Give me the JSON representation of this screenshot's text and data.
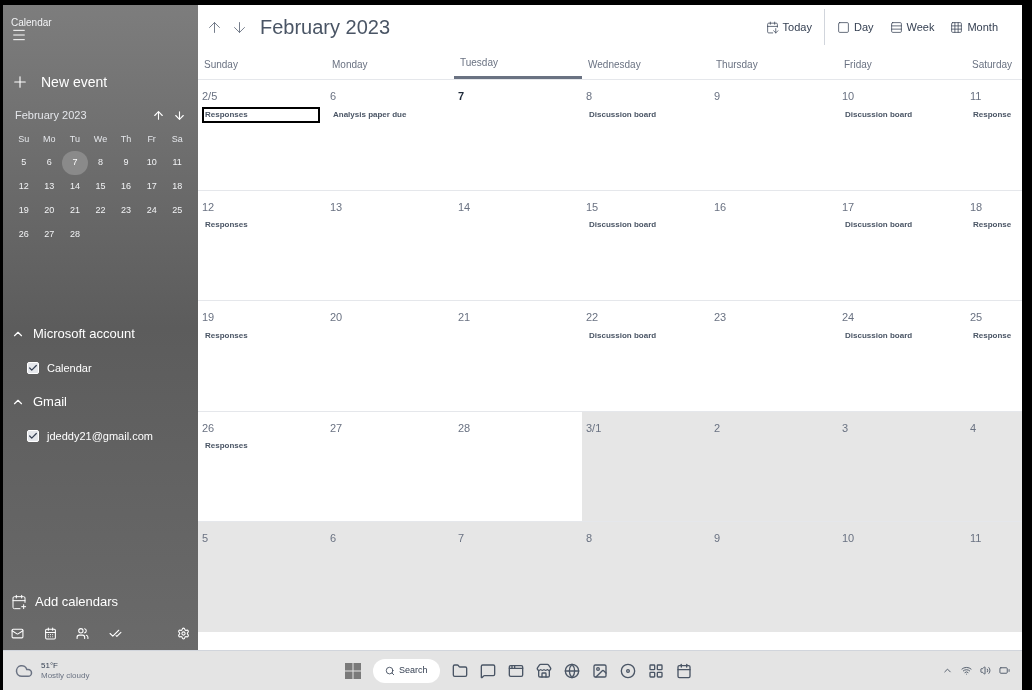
{
  "window": {
    "title": "Calendar"
  },
  "sidebar": {
    "new_event": "New event",
    "mini_calendar": {
      "month": "February 2023",
      "weekdays": [
        "Su",
        "Mo",
        "Tu",
        "We",
        "Th",
        "Fr",
        "Sa"
      ],
      "weeks": [
        [
          {
            "day": "5",
            "today": false
          },
          {
            "day": "6",
            "today": false
          },
          {
            "day": "7",
            "today": true
          },
          {
            "day": "8",
            "today": false
          },
          {
            "day": "9",
            "today": false
          },
          {
            "day": "10",
            "today": false
          },
          {
            "day": "11",
            "today": false
          }
        ],
        [
          {
            "day": "12",
            "today": false
          },
          {
            "day": "13",
            "today": false
          },
          {
            "day": "14",
            "today": false
          },
          {
            "day": "15",
            "today": false
          },
          {
            "day": "16",
            "today": false
          },
          {
            "day": "17",
            "today": false
          },
          {
            "day": "18",
            "today": false
          }
        ],
        [
          {
            "day": "19",
            "today": false
          },
          {
            "day": "20",
            "today": false
          },
          {
            "day": "21",
            "today": false
          },
          {
            "day": "22",
            "today": false
          },
          {
            "day": "23",
            "today": false
          },
          {
            "day": "24",
            "today": false
          },
          {
            "day": "25",
            "today": false
          }
        ],
        [
          {
            "day": "26",
            "today": false
          },
          {
            "day": "27",
            "today": false
          },
          {
            "day": "28",
            "today": false
          }
        ]
      ]
    },
    "accounts": [
      {
        "name": "Microsoft account",
        "expanded": true,
        "calendars": [
          {
            "label": "Calendar",
            "checked": true
          }
        ]
      },
      {
        "name": "Gmail",
        "expanded": true,
        "calendars": [
          {
            "label": "jdeddy21@gmail.com",
            "checked": true
          }
        ]
      }
    ],
    "add_calendars": "Add calendars"
  },
  "header": {
    "title": "February 2023",
    "views": [
      {
        "label": "Today",
        "kind": "today"
      },
      {
        "label": "Day",
        "kind": "day"
      },
      {
        "label": "Week",
        "kind": "week"
      },
      {
        "label": "Month",
        "kind": "month"
      }
    ]
  },
  "grid": {
    "weekdays": [
      {
        "label": "Sunday",
        "today": false
      },
      {
        "label": "Monday",
        "today": false
      },
      {
        "label": "Tuesday",
        "today": true
      },
      {
        "label": "Wednesday",
        "today": false
      },
      {
        "label": "Thursday",
        "today": false
      },
      {
        "label": "Friday",
        "today": false
      },
      {
        "label": "Saturday",
        "today": false
      }
    ],
    "weeks": [
      [
        {
          "date": "2/5",
          "in_month": true,
          "today": false,
          "event": {
            "title": "Responses",
            "selected": true
          }
        },
        {
          "date": "6",
          "in_month": true,
          "today": false,
          "event": {
            "title": "Analysis paper due",
            "selected": false
          }
        },
        {
          "date": "7",
          "in_month": true,
          "today": true
        },
        {
          "date": "8",
          "in_month": true,
          "today": false,
          "event": {
            "title": "Discussion board",
            "selected": false
          }
        },
        {
          "date": "9",
          "in_month": true,
          "today": false
        },
        {
          "date": "10",
          "in_month": true,
          "today": false,
          "event": {
            "title": "Discussion board",
            "selected": false
          }
        },
        {
          "date": "11",
          "in_month": true,
          "today": false,
          "event": {
            "title": "Response",
            "selected": false
          }
        }
      ],
      [
        {
          "date": "12",
          "in_month": true,
          "today": false,
          "event": {
            "title": "Responses",
            "selected": false
          }
        },
        {
          "date": "13",
          "in_month": true,
          "today": false
        },
        {
          "date": "14",
          "in_month": true,
          "today": false
        },
        {
          "date": "15",
          "in_month": true,
          "today": false,
          "event": {
            "title": "Discussion board",
            "selected": false
          }
        },
        {
          "date": "16",
          "in_month": true,
          "today": false
        },
        {
          "date": "17",
          "in_month": true,
          "today": false,
          "event": {
            "title": "Discussion board",
            "selected": false
          }
        },
        {
          "date": "18",
          "in_month": true,
          "today": false,
          "event": {
            "title": "Response",
            "selected": false
          }
        }
      ],
      [
        {
          "date": "19",
          "in_month": true,
          "today": false,
          "event": {
            "title": "Responses",
            "selected": false
          }
        },
        {
          "date": "20",
          "in_month": true,
          "today": false
        },
        {
          "date": "21",
          "in_month": true,
          "today": false
        },
        {
          "date": "22",
          "in_month": true,
          "today": false,
          "event": {
            "title": "Discussion board",
            "selected": false
          }
        },
        {
          "date": "23",
          "in_month": true,
          "today": false
        },
        {
          "date": "24",
          "in_month": true,
          "today": false,
          "event": {
            "title": "Discussion board",
            "selected": false
          }
        },
        {
          "date": "25",
          "in_month": true,
          "today": false,
          "event": {
            "title": "Response",
            "selected": false
          }
        }
      ],
      [
        {
          "date": "26",
          "in_month": true,
          "today": false,
          "event": {
            "title": "Responses",
            "selected": false
          }
        },
        {
          "date": "27",
          "in_month": true,
          "today": false
        },
        {
          "date": "28",
          "in_month": true,
          "today": false
        },
        {
          "date": "3/1",
          "in_month": false,
          "today": false
        },
        {
          "date": "2",
          "in_month": false,
          "today": false
        },
        {
          "date": "3",
          "in_month": false,
          "today": false
        },
        {
          "date": "4",
          "in_month": false,
          "today": false
        }
      ],
      [
        {
          "date": "5",
          "in_month": false,
          "today": false
        },
        {
          "date": "6",
          "in_month": false,
          "today": false
        },
        {
          "date": "7",
          "in_month": false,
          "today": false
        },
        {
          "date": "8",
          "in_month": false,
          "today": false
        },
        {
          "date": "9",
          "in_month": false,
          "today": false
        },
        {
          "date": "10",
          "in_month": false,
          "today": false
        },
        {
          "date": "11",
          "in_month": false,
          "today": false
        }
      ]
    ]
  },
  "taskbar": {
    "weather": {
      "temperature": "51°F",
      "condition": "Mostly cloudy"
    },
    "search": "Search"
  }
}
